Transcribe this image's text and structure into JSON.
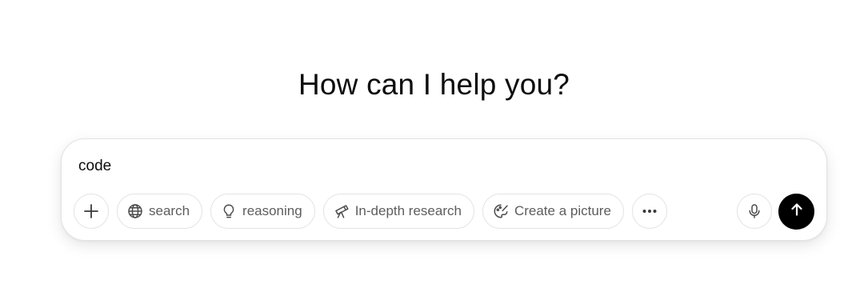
{
  "headline": "How can I help you?",
  "composer": {
    "input_value": "code",
    "tools": [
      {
        "label": "search",
        "icon": "globe-icon"
      },
      {
        "label": "reasoning",
        "icon": "lightbulb-icon"
      },
      {
        "label": "In-depth research",
        "icon": "telescope-icon"
      },
      {
        "label": "Create a picture",
        "icon": "palette-icon"
      }
    ],
    "icons": {
      "add": "plus-icon",
      "more": "more-dots-icon",
      "voice": "microphone-icon",
      "send": "arrow-up-icon"
    }
  },
  "colors": {
    "send_button": "#000000",
    "chip_border": "#e3e3e3",
    "chip_text": "#5d5d5d"
  }
}
